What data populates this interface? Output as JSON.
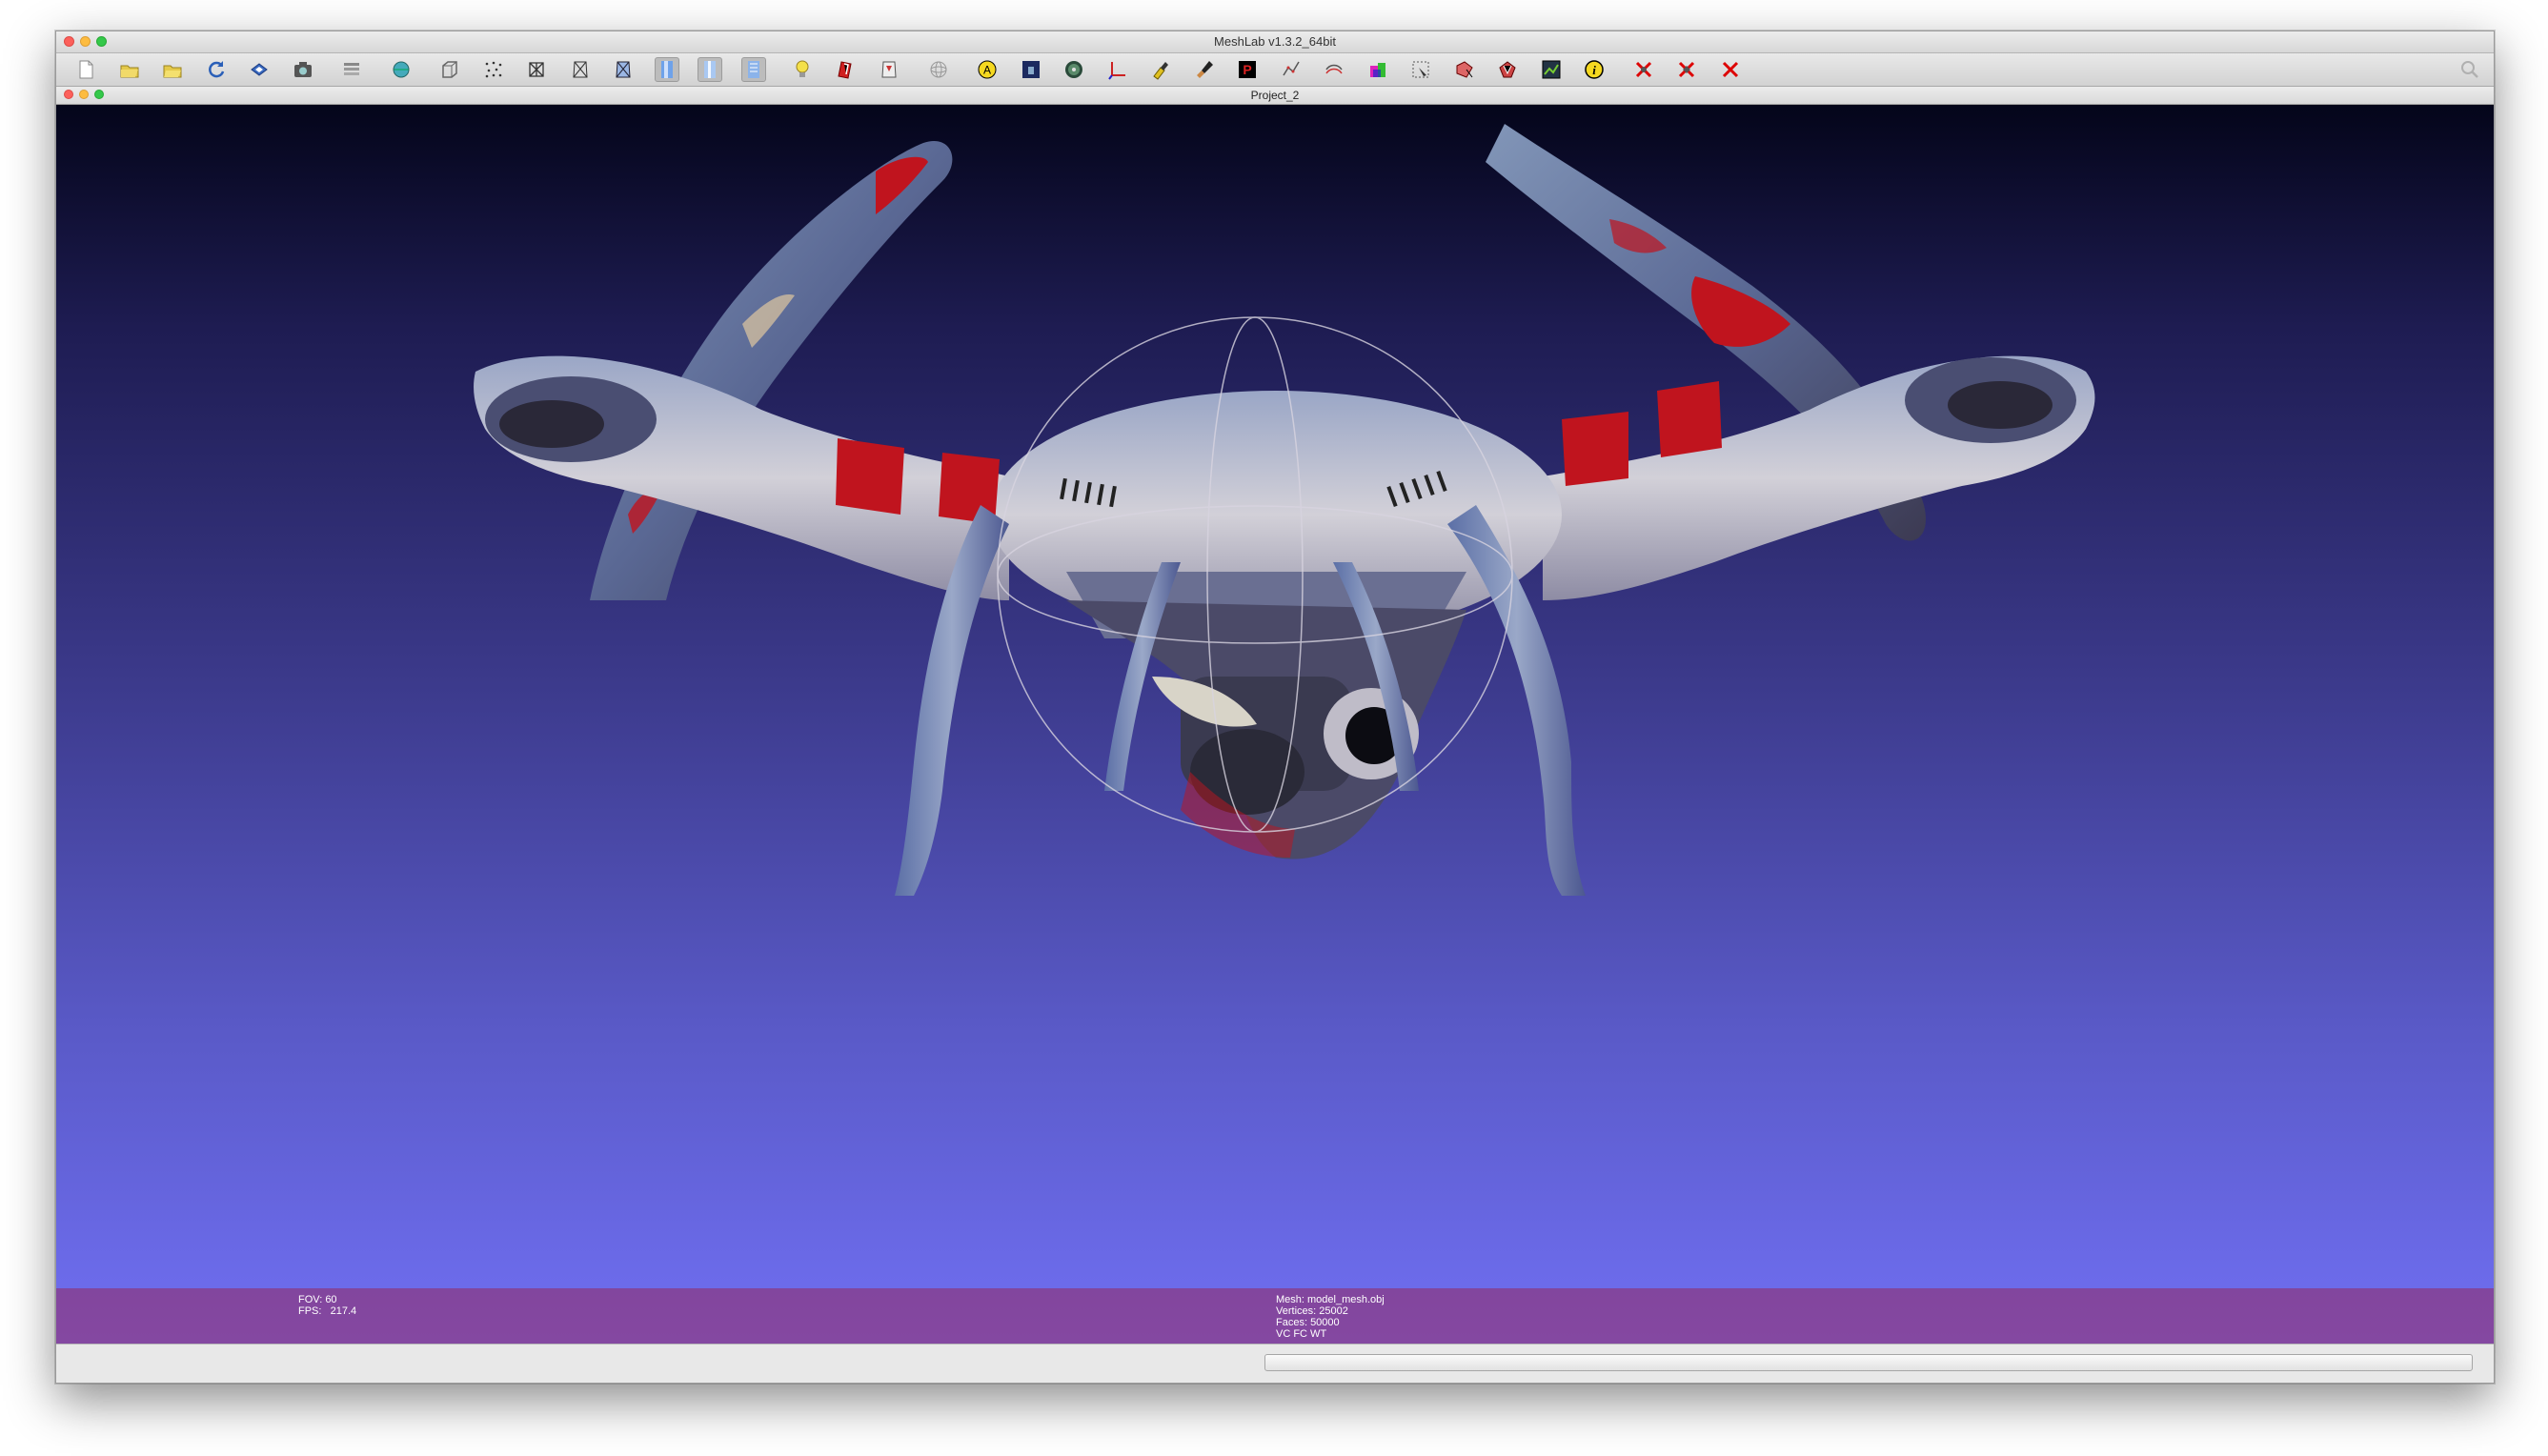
{
  "window": {
    "title": "MeshLab v1.3.2_64bit",
    "document_title": "Project_2"
  },
  "toolbar": {
    "icons": [
      "new-project-icon",
      "open-project-icon",
      "open-mesh-icon",
      "reload-icon",
      "save-icon",
      "snapshot-icon",
      "layers-icon",
      "color-globe-icon",
      "bounding-box-icon",
      "points-icon",
      "wireframe-icon",
      "hidden-lines-icon",
      "flat-lines-icon",
      "flat-shading-icon",
      "smooth-shading-icon",
      "texture-icon",
      "light-icon",
      "fancy-lighting-icon",
      "back-face-icon",
      "trackball-icon",
      "annotation-icon",
      "quality-map-icon",
      "measure-icon",
      "axis-icon",
      "paint-icon",
      "brush-icon",
      "pick-points-icon",
      "align-icon",
      "manipulator-icon",
      "color-paint-icon",
      "select-faces-icon",
      "select-vertices-icon",
      "select-connected-icon",
      "raster-icon",
      "info-icon",
      "delete-faces-icon",
      "delete-vertices-icon",
      "delete-all-icon"
    ],
    "pressed": [
      "flat-shading-icon",
      "smooth-shading-icon",
      "texture-icon"
    ]
  },
  "viewport": {
    "info_left": "FOV: 60\nFPS:   217.4",
    "mesh_name": "Mesh: model_mesh.obj",
    "vertices": "Vertices: 25002",
    "faces": "Faces: 50000",
    "render_mode": "VC FC WT"
  },
  "colors": {
    "accent_red": "#c0141e",
    "drone_body": "#c9c8cf",
    "background_top": "#04051a",
    "background_bottom": "#706ff2",
    "infobar": "#96285f"
  }
}
